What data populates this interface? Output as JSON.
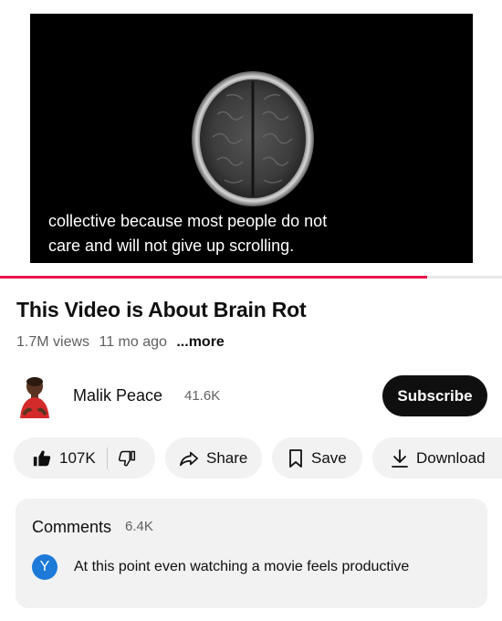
{
  "video": {
    "caption_line1": "collective because most people do not",
    "caption_line2": "care and will not give up scrolling.",
    "progress_fraction": 0.85,
    "progress_color": "#e8134a"
  },
  "details": {
    "title": "This Video is About Brain Rot",
    "views": "1.7M views",
    "age": "11 mo ago",
    "more_label": "...more"
  },
  "channel": {
    "name": "Malik Peace",
    "subscribers": "41.6K",
    "subscribe_label": "Subscribe"
  },
  "actions": {
    "like_count": "107K",
    "share_label": "Share",
    "save_label": "Save",
    "download_label": "Download"
  },
  "comments": {
    "title": "Comments",
    "count": "6.4K",
    "top_comment": {
      "avatar_letter": "Y",
      "avatar_color": "#1e7ad8",
      "text": "At this point even watching a movie feels productive"
    }
  },
  "icons": {
    "like": "thumbs-up-icon",
    "dislike": "thumbs-down-icon",
    "share": "share-arrow-icon",
    "save": "bookmark-icon",
    "download": "download-arrow-icon"
  }
}
